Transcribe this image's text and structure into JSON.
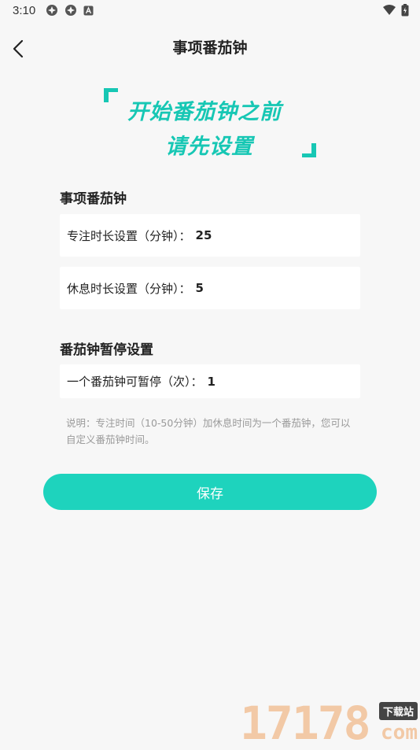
{
  "status_bar": {
    "time": "3:10"
  },
  "nav": {
    "title": "事项番茄钟"
  },
  "banner": {
    "line1": "开始番茄钟之前",
    "line2": "请先设置"
  },
  "section_pomodoro": {
    "title": "事项番茄钟",
    "focus": {
      "label": "专注时长设置（分钟）：",
      "value": "25"
    },
    "rest": {
      "label": "休息时长设置（分钟）：",
      "value": "5"
    }
  },
  "section_pause": {
    "title": "番茄钟暂停设置",
    "pause": {
      "label": "一个番茄钟可暂停（次）：",
      "value": "1"
    }
  },
  "note": "说明：专注时间（10-50分钟）加休息时间为一个番茄钟，您可以自定义番茄钟时间。",
  "save_label": "保存",
  "watermark": {
    "digits": "17178",
    "badge": "下载站",
    "suffix": "com"
  },
  "colors": {
    "accent": "#1ed3bd",
    "banner_text": "#17c7b4",
    "background": "#f7f7f7"
  }
}
